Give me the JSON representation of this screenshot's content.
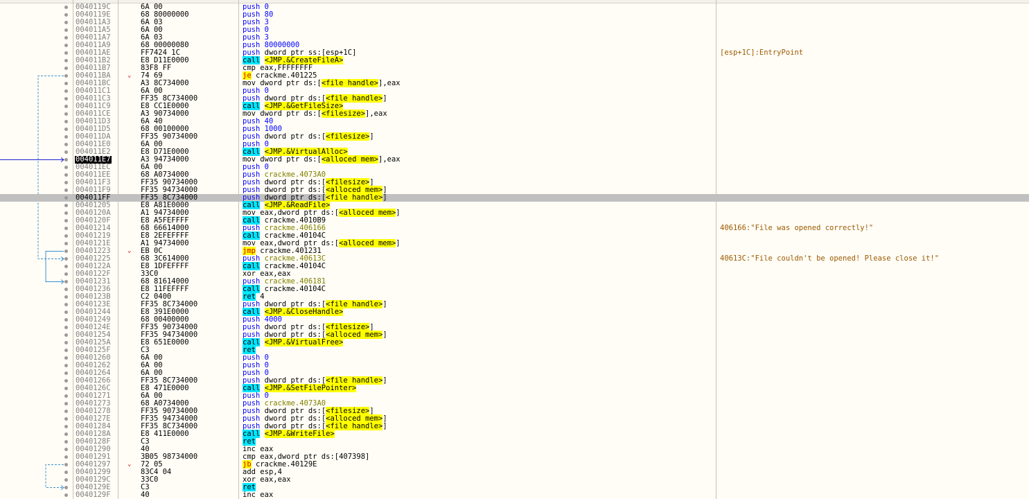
{
  "comments": {
    "esp": "[esp+1C]:EntryPoint",
    "opened": "406166:\"File was opened correctly!\"",
    "failed": "40613C:\"File couldn't be opened! Please close it!\""
  },
  "rows": [
    {
      "addr": "0040119C",
      "bytes": "6A 00",
      "mn": "push",
      "ops": "0"
    },
    {
      "addr": "0040119E",
      "bytes": "68 80000000",
      "mn": "push",
      "ops": "80"
    },
    {
      "addr": "004011A3",
      "bytes": "6A 03",
      "mn": "push",
      "ops": "3"
    },
    {
      "addr": "004011A5",
      "bytes": "6A 00",
      "mn": "push",
      "ops": "0"
    },
    {
      "addr": "004011A7",
      "bytes": "6A 03",
      "mn": "push",
      "ops": "3"
    },
    {
      "addr": "004011A9",
      "bytes": "68 00000080",
      "mn": "push",
      "ops": "80000000"
    },
    {
      "addr": "004011AE",
      "bytes": "FF7424 1C",
      "mn": "push",
      "ops": "dword ptr ss:[esp+1C]",
      "cmt": "esp"
    },
    {
      "addr": "004011B2",
      "bytes": "E8 D11E0000",
      "mn": "call",
      "ops": "<JMP.&CreateFileA>"
    },
    {
      "addr": "004011B7",
      "bytes": "83F8 FF",
      "mn": "cmp",
      "ops": "eax,FFFFFFFF"
    },
    {
      "addr": "004011BA",
      "bytes": "74 69",
      "mn": "je",
      "ops": "crackme.401225",
      "chev": true
    },
    {
      "addr": "004011BC",
      "bytes": "A3 8C734000",
      "mn": "mov",
      "ops": "dword ptr ds:[<file handle>],eax"
    },
    {
      "addr": "004011C1",
      "bytes": "6A 00",
      "mn": "push",
      "ops": "0"
    },
    {
      "addr": "004011C3",
      "bytes": "FF35 8C734000",
      "mn": "push",
      "ops": "dword ptr ds:[<file handle>]"
    },
    {
      "addr": "004011C9",
      "bytes": "E8 CC1E0000",
      "mn": "call",
      "ops": "<JMP.&GetFileSize>"
    },
    {
      "addr": "004011CE",
      "bytes": "A3 90734000",
      "mn": "mov",
      "ops": "dword ptr ds:[<filesize>],eax"
    },
    {
      "addr": "004011D3",
      "bytes": "6A 40",
      "mn": "push",
      "ops": "40"
    },
    {
      "addr": "004011D5",
      "bytes": "68 00100000",
      "mn": "push",
      "ops": "1000"
    },
    {
      "addr": "004011DA",
      "bytes": "FF35 90734000",
      "mn": "push",
      "ops": "dword ptr ds:[<filesize>]"
    },
    {
      "addr": "004011E0",
      "bytes": "6A 00",
      "mn": "push",
      "ops": "0"
    },
    {
      "addr": "004011E2",
      "bytes": "E8 D71E0000",
      "mn": "call",
      "ops": "<JMP.&VirtualAlloc>"
    },
    {
      "addr": "004011E7",
      "bytes": "A3 94734000",
      "mn": "mov",
      "ops": "dword ptr ds:[<alloced mem>],eax",
      "cur": true
    },
    {
      "addr": "004011EC",
      "bytes": "6A 00",
      "mn": "push",
      "ops": "0"
    },
    {
      "addr": "004011EE",
      "bytes": "68 A0734000",
      "mn": "push",
      "ops": "crackme.4073A0"
    },
    {
      "addr": "004011F3",
      "bytes": "FF35 90734000",
      "mn": "push",
      "ops": "dword ptr ds:[<filesize>]"
    },
    {
      "addr": "004011F9",
      "bytes": "FF35 94734000",
      "mn": "push",
      "ops": "dword ptr ds:[<alloced mem>]"
    },
    {
      "addr": "004011FF",
      "bytes": "FF35 8C734000",
      "mn": "push",
      "ops": "dword ptr ds:[<file handle>]",
      "sel": true
    },
    {
      "addr": "00401205",
      "bytes": "E8 A81E0000",
      "mn": "call",
      "ops": "<JMP.&ReadFile>"
    },
    {
      "addr": "0040120A",
      "bytes": "A1 94734000",
      "mn": "mov",
      "ops": "eax,dword ptr ds:[<alloced mem>]"
    },
    {
      "addr": "0040120F",
      "bytes": "E8 A5FEFFFF",
      "mn": "call",
      "ops": "crackme.4010B9"
    },
    {
      "addr": "00401214",
      "bytes": "68 66614000",
      "mn": "push",
      "ops": "crackme.406166",
      "cmt": "opened"
    },
    {
      "addr": "00401219",
      "bytes": "E8 2EFEFFFF",
      "mn": "call",
      "ops": "crackme.40104C"
    },
    {
      "addr": "0040121E",
      "bytes": "A1 94734000",
      "mn": "mov",
      "ops": "eax,dword ptr ds:[<alloced mem>]"
    },
    {
      "addr": "00401223",
      "bytes": "EB 0C",
      "mn": "jmp",
      "ops": "crackme.401231",
      "chev": true
    },
    {
      "addr": "00401225",
      "bytes": "68 3C614000",
      "mn": "push",
      "ops": "crackme.40613C",
      "cmt": "failed"
    },
    {
      "addr": "0040122A",
      "bytes": "E8 1DFEFFFF",
      "mn": "call",
      "ops": "crackme.40104C"
    },
    {
      "addr": "0040122F",
      "bytes": "33C0",
      "mn": "xor",
      "ops": "eax,eax"
    },
    {
      "addr": "00401231",
      "bytes": "68 81614000",
      "mn": "push",
      "ops": "crackme.406181"
    },
    {
      "addr": "00401236",
      "bytes": "E8 11FEFFFF",
      "mn": "call",
      "ops": "crackme.40104C"
    },
    {
      "addr": "0040123B",
      "bytes": "C2 0400",
      "mn": "ret",
      "ops": "4"
    },
    {
      "addr": "0040123E",
      "bytes": "FF35 8C734000",
      "mn": "push",
      "ops": "dword ptr ds:[<file handle>]"
    },
    {
      "addr": "00401244",
      "bytes": "E8 391E0000",
      "mn": "call",
      "ops": "<JMP.&CloseHandle>"
    },
    {
      "addr": "00401249",
      "bytes": "68 00400000",
      "mn": "push",
      "ops": "4000"
    },
    {
      "addr": "0040124E",
      "bytes": "FF35 90734000",
      "mn": "push",
      "ops": "dword ptr ds:[<filesize>]"
    },
    {
      "addr": "00401254",
      "bytes": "FF35 94734000",
      "mn": "push",
      "ops": "dword ptr ds:[<alloced mem>]"
    },
    {
      "addr": "0040125A",
      "bytes": "E8 651E0000",
      "mn": "call",
      "ops": "<JMP.&VirtualFree>"
    },
    {
      "addr": "0040125F",
      "bytes": "C3",
      "mn": "ret",
      "ops": ""
    },
    {
      "addr": "00401260",
      "bytes": "6A 00",
      "mn": "push",
      "ops": "0"
    },
    {
      "addr": "00401262",
      "bytes": "6A 00",
      "mn": "push",
      "ops": "0"
    },
    {
      "addr": "00401264",
      "bytes": "6A 00",
      "mn": "push",
      "ops": "0"
    },
    {
      "addr": "00401266",
      "bytes": "FF35 8C734000",
      "mn": "push",
      "ops": "dword ptr ds:[<file handle>]"
    },
    {
      "addr": "0040126C",
      "bytes": "E8 471E0000",
      "mn": "call",
      "ops": "<JMP.&SetFilePointer>"
    },
    {
      "addr": "00401271",
      "bytes": "6A 00",
      "mn": "push",
      "ops": "0"
    },
    {
      "addr": "00401273",
      "bytes": "68 A0734000",
      "mn": "push",
      "ops": "crackme.4073A0"
    },
    {
      "addr": "00401278",
      "bytes": "FF35 90734000",
      "mn": "push",
      "ops": "dword ptr ds:[<filesize>]"
    },
    {
      "addr": "0040127E",
      "bytes": "FF35 94734000",
      "mn": "push",
      "ops": "dword ptr ds:[<alloced mem>]"
    },
    {
      "addr": "00401284",
      "bytes": "FF35 8C734000",
      "mn": "push",
      "ops": "dword ptr ds:[<file handle>]"
    },
    {
      "addr": "0040128A",
      "bytes": "E8 411E0000",
      "mn": "call",
      "ops": "<JMP.&WriteFile>"
    },
    {
      "addr": "0040128F",
      "bytes": "C3",
      "mn": "ret",
      "ops": ""
    },
    {
      "addr": "00401290",
      "bytes": "40",
      "mn": "inc",
      "ops": "eax"
    },
    {
      "addr": "00401291",
      "bytes": "3B05 98734000",
      "mn": "cmp",
      "ops": "eax,dword ptr ds:[407398]"
    },
    {
      "addr": "00401297",
      "bytes": "72 05",
      "mn": "jb",
      "ops": "crackme.40129E",
      "chev": true
    },
    {
      "addr": "00401299",
      "bytes": "83C4 04",
      "mn": "add",
      "ops": "esp,4"
    },
    {
      "addr": "0040129C",
      "bytes": "33C0",
      "mn": "xor",
      "ops": "eax,eax"
    },
    {
      "addr": "0040129E",
      "bytes": "C3",
      "mn": "ret",
      "ops": ""
    },
    {
      "addr": "0040129F",
      "bytes": "40",
      "mn": "inc",
      "ops": "eax"
    }
  ]
}
